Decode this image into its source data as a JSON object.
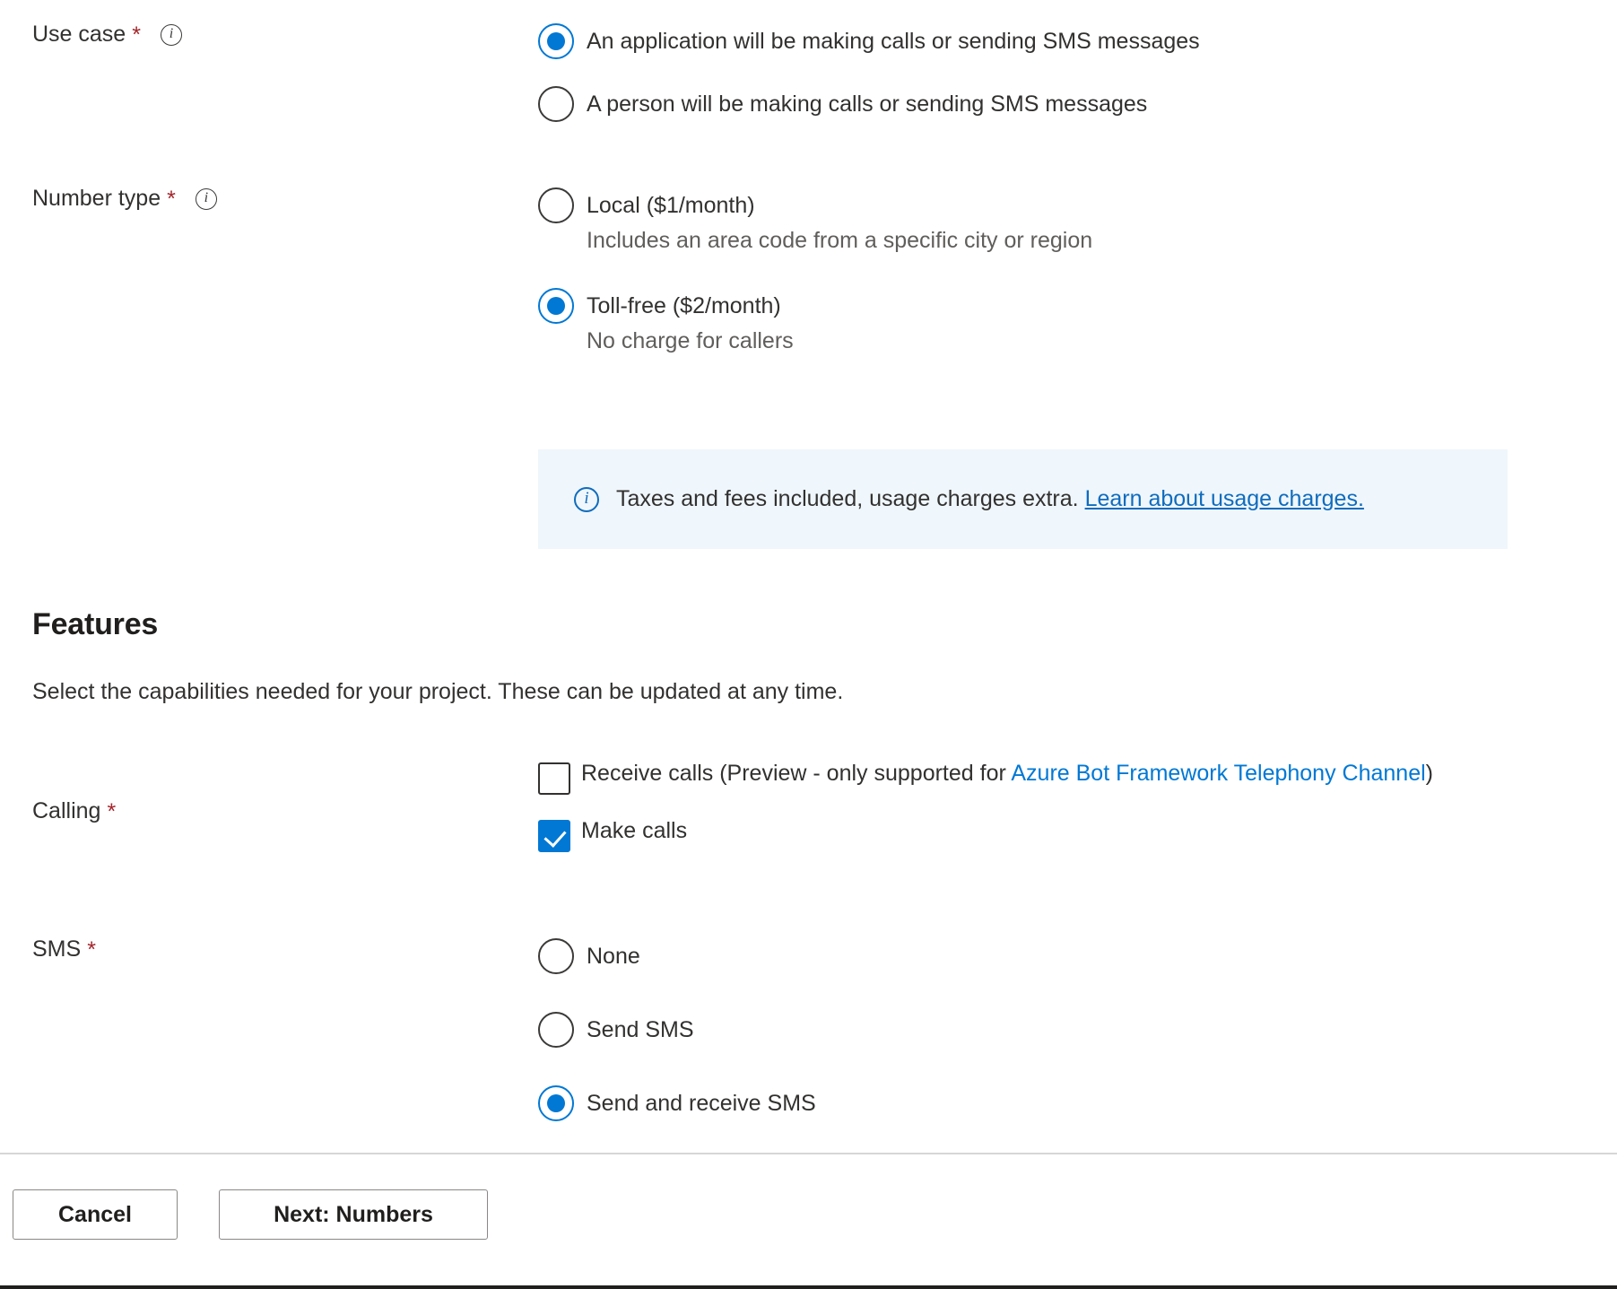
{
  "form": {
    "use_case": {
      "label": "Use case",
      "required_marker": "*",
      "info_icon": "info-icon",
      "options": [
        {
          "label": "An application will be making calls or sending SMS messages",
          "selected": true
        },
        {
          "label": "A person will be making calls or sending SMS messages",
          "selected": false
        }
      ]
    },
    "number_type": {
      "label": "Number type",
      "required_marker": "*",
      "info_icon": "info-icon",
      "options": [
        {
          "label": "Local ($1/month)",
          "sub": "Includes an area code from a specific city or region",
          "selected": false
        },
        {
          "label": "Toll-free ($2/month)",
          "sub": "No charge for callers",
          "selected": true
        }
      ]
    },
    "info_banner": {
      "icon": "info-circle-icon",
      "text": "Taxes and fees included, usage charges extra.",
      "link_text": "Learn about usage charges.",
      "background_color": "#eff6fc",
      "link_color": "#0f6cbd"
    }
  },
  "features": {
    "title": "Features",
    "description": "Select the capabilities needed for your project. These can be updated at any time.",
    "calling": {
      "label": "Calling",
      "required_marker": "*",
      "options": [
        {
          "text_before": "Receive calls (Preview - only supported for ",
          "link_text": "Azure Bot Framework Telephony Channel",
          "text_after": ")",
          "checked": false
        },
        {
          "text_before": "Make calls",
          "link_text": "",
          "text_after": "",
          "checked": true
        }
      ]
    },
    "sms": {
      "label": "SMS",
      "required_marker": "*",
      "options": [
        {
          "label": "None",
          "selected": false
        },
        {
          "label": "Send SMS",
          "selected": false
        },
        {
          "label": "Send and receive SMS",
          "selected": true
        }
      ]
    }
  },
  "footer": {
    "cancel_label": "Cancel",
    "next_label": "Next: Numbers"
  },
  "colors": {
    "accent": "#0078d4",
    "required": "#a4262c",
    "link": "#0f6cbd",
    "banner_bg": "#eff6fc",
    "text": "#323130",
    "subtext": "#605e5c"
  }
}
